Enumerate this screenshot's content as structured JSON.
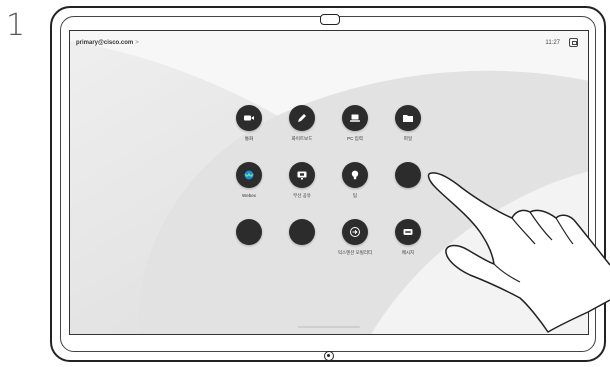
{
  "step_number": "1",
  "screen": {
    "account": "primary@cisco.com",
    "account_chevron": ">",
    "time": "11:27",
    "status_icon": "screen-share-icon"
  },
  "tiles": [
    {
      "label": "통화",
      "icon": "camera-icon"
    },
    {
      "label": "화이트보드",
      "icon": "pencil-icon"
    },
    {
      "label": "PC 입력",
      "icon": "laptop-icon"
    },
    {
      "label": "파일",
      "icon": "folder-icon"
    },
    {
      "label": "Webex",
      "icon": "webex-icon"
    },
    {
      "label": "무선 공유",
      "icon": "cast-icon"
    },
    {
      "label": "팁",
      "icon": "lightbulb-icon"
    },
    {
      "label": "",
      "icon": ""
    },
    {
      "label": "",
      "icon": ""
    },
    {
      "label": "",
      "icon": ""
    },
    {
      "label": "익스텐션 모빌리티",
      "icon": "sign-in-icon"
    },
    {
      "label": "메시지",
      "icon": "message-icon"
    }
  ],
  "colors": {
    "tile": "#2c2c2c",
    "screen_bg": "#e8e8e8",
    "webex_accent": "#1d8ccf"
  }
}
